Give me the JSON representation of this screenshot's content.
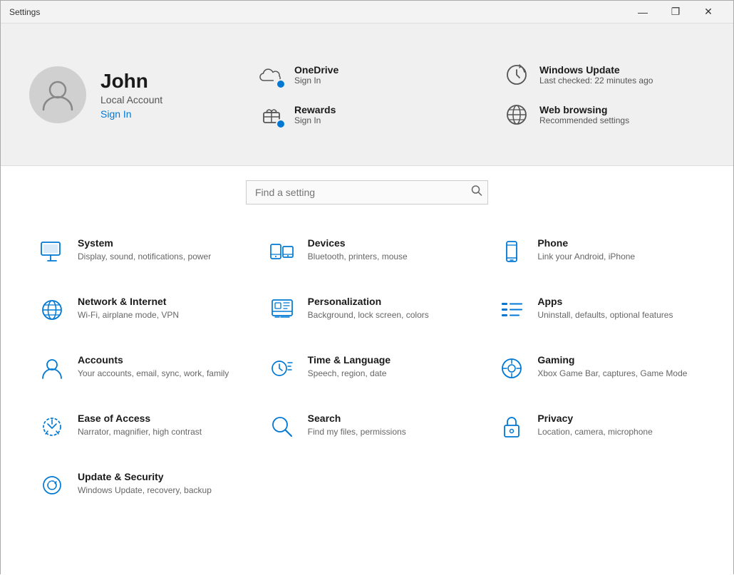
{
  "titlebar": {
    "title": "Settings",
    "minimize": "—",
    "maximize": "❐",
    "close": "✕"
  },
  "header": {
    "user": {
      "name": "John",
      "account": "Local Account",
      "signin_label": "Sign In"
    },
    "cloud_items": [
      {
        "id": "onedrive",
        "label": "OneDrive",
        "sub": "Sign In",
        "has_badge": true
      },
      {
        "id": "windows-update",
        "label": "Windows Update",
        "sub": "Last checked: 22 minutes ago",
        "has_badge": false
      },
      {
        "id": "rewards",
        "label": "Rewards",
        "sub": "Sign In",
        "has_badge": true
      },
      {
        "id": "web-browsing",
        "label": "Web browsing",
        "sub": "Recommended settings",
        "has_badge": false
      }
    ]
  },
  "search": {
    "placeholder": "Find a setting"
  },
  "settings": [
    {
      "id": "system",
      "title": "System",
      "desc": "Display, sound, notifications, power"
    },
    {
      "id": "devices",
      "title": "Devices",
      "desc": "Bluetooth, printers, mouse"
    },
    {
      "id": "phone",
      "title": "Phone",
      "desc": "Link your Android, iPhone"
    },
    {
      "id": "network",
      "title": "Network & Internet",
      "desc": "Wi-Fi, airplane mode, VPN"
    },
    {
      "id": "personalization",
      "title": "Personalization",
      "desc": "Background, lock screen, colors"
    },
    {
      "id": "apps",
      "title": "Apps",
      "desc": "Uninstall, defaults, optional features"
    },
    {
      "id": "accounts",
      "title": "Accounts",
      "desc": "Your accounts, email, sync, work, family"
    },
    {
      "id": "time-language",
      "title": "Time & Language",
      "desc": "Speech, region, date"
    },
    {
      "id": "gaming",
      "title": "Gaming",
      "desc": "Xbox Game Bar, captures, Game Mode"
    },
    {
      "id": "ease-of-access",
      "title": "Ease of Access",
      "desc": "Narrator, magnifier, high contrast"
    },
    {
      "id": "search",
      "title": "Search",
      "desc": "Find my files, permissions"
    },
    {
      "id": "privacy",
      "title": "Privacy",
      "desc": "Location, camera, microphone"
    },
    {
      "id": "update-security",
      "title": "Update & Security",
      "desc": "Windows Update, recovery, backup"
    }
  ],
  "colors": {
    "accent": "#0078d4",
    "icon": "#0078d4"
  }
}
